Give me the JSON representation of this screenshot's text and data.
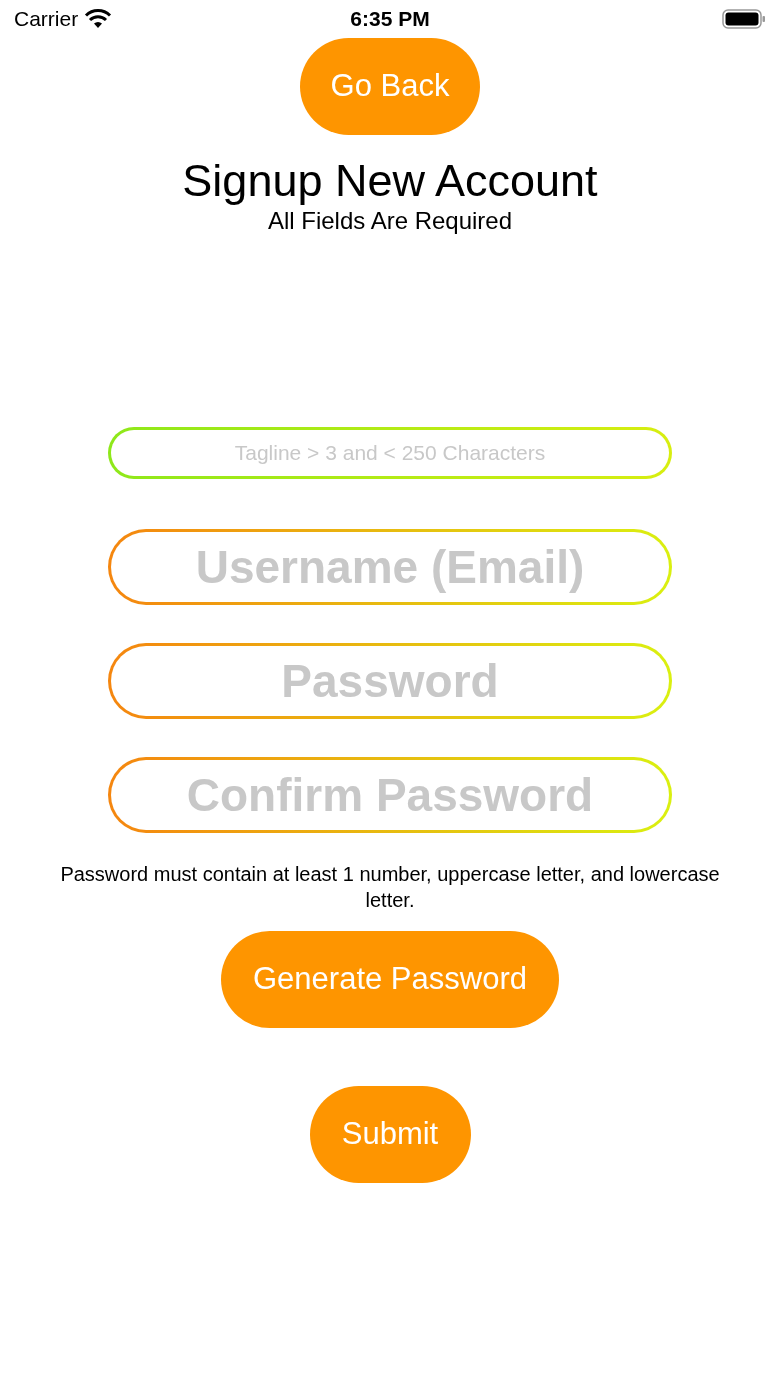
{
  "status_bar": {
    "carrier": "Carrier",
    "time": "6:35 PM"
  },
  "back_button": "Go Back",
  "title": "Signup New Account",
  "subtitle": "All Fields Are Required",
  "fields": [
    {
      "kind": "tagline",
      "placeholder": "Tagline > 3 and < 250 Characters"
    },
    {
      "kind": "large",
      "placeholder": "Username (Email)"
    },
    {
      "kind": "large",
      "placeholder": "Password"
    },
    {
      "kind": "large",
      "placeholder": "Confirm Password"
    }
  ],
  "password_hint": "Password must contain at least 1 number, uppercase letter, and lowercase letter.",
  "generate_button": "Generate Password",
  "submit_button": "Submit"
}
